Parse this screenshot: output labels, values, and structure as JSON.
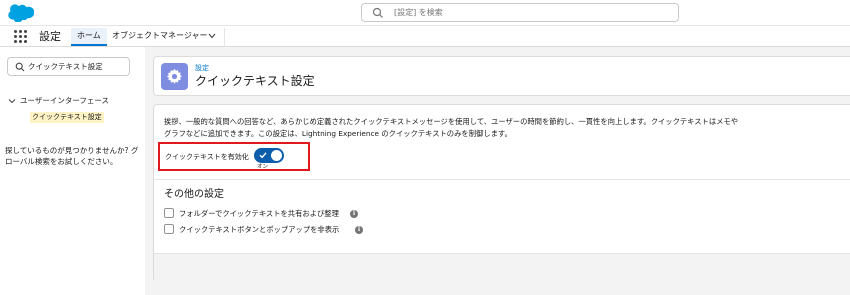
{
  "header": {
    "logo": "salesforce-cloud-icon",
    "search": {
      "placeholder": "[設定] を検索",
      "icon": "search-icon"
    }
  },
  "nav": {
    "app_title": "設定",
    "tabs": [
      {
        "label": "ホーム",
        "selected": true
      },
      {
        "label": "オブジェクトマネージャー",
        "selected": false
      }
    ]
  },
  "sidebar": {
    "quick_find_value": "クイックテキスト設定",
    "tree_parent": "ユーザーインターフェース",
    "tree_child": "クイックテキスト設定",
    "help": "探しているものが見つかりませんか? グローバル検索をお試しください。"
  },
  "page_header": {
    "breadcrumb": "設定",
    "title": "クイックテキスト設定"
  },
  "main": {
    "description": "挨拶、一般的な質問への回答など、あらかじめ定義されたクイックテキストメッセージを使用して、ユーザーの時間を節約し、一貫性を向上します。クイックテキストはメモやグラフなどに追加できます。この設定は、Lightning Experience のクイックテキストのみを制御します。",
    "toggle": {
      "label": "クイックテキストを有効化",
      "state_label": "オン",
      "enabled": true
    },
    "other_settings_title": "その他の設定",
    "options": [
      {
        "label": "フォルダーでクイックテキストを共有および整理",
        "checked": false
      },
      {
        "label": "クイックテキストボタンとポップアップを非表示",
        "checked": false
      }
    ]
  },
  "colors": {
    "brand_blue": "#0176d3",
    "toggle_on": "#0b5cab",
    "highlight_border": "#e0191f",
    "setup_icon_bg": "#7f8de1",
    "tree_highlight": "#fdf3c5"
  }
}
